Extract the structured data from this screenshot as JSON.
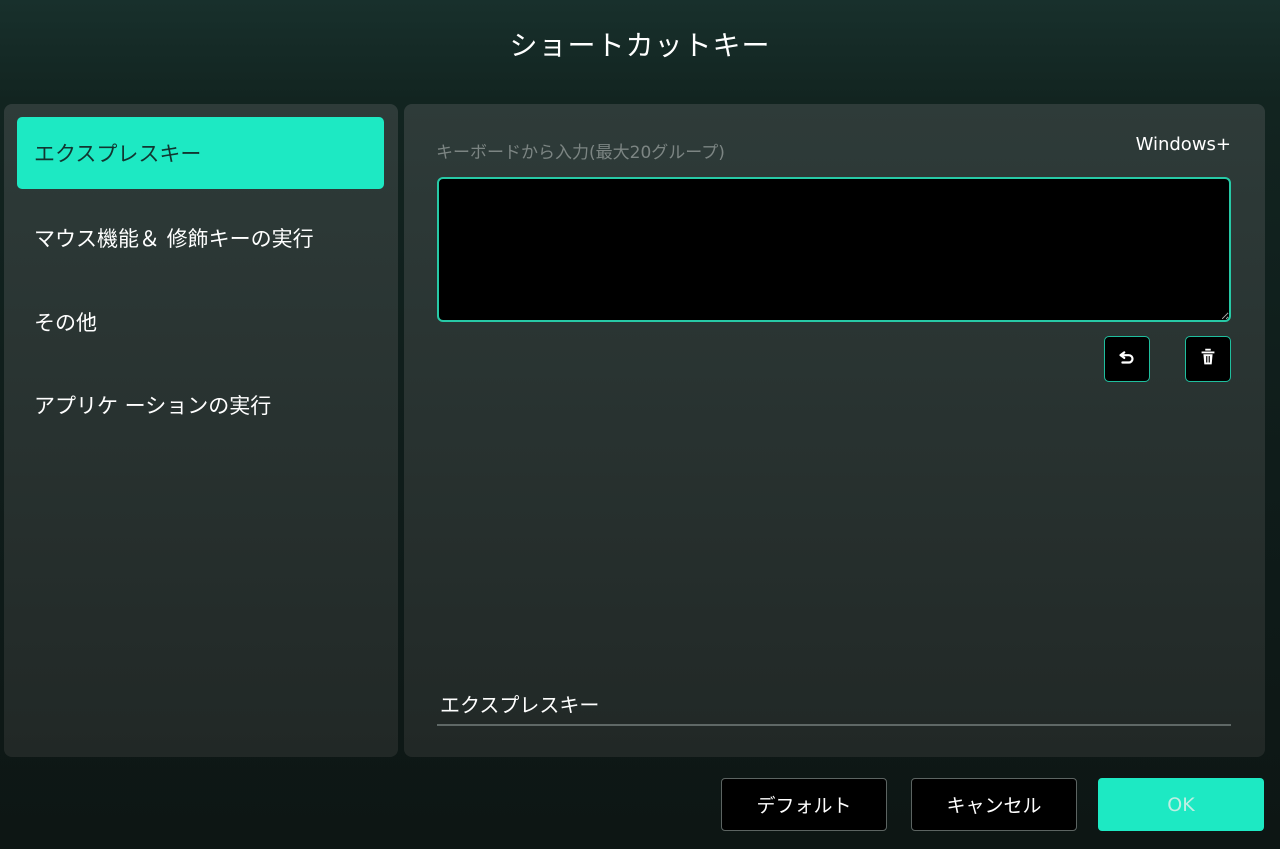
{
  "dialog": {
    "title": "ショートカットキー"
  },
  "sidebar": {
    "items": [
      {
        "label": "エクスプレスキー",
        "active": true
      },
      {
        "label": "マウス機能＆ 修飾キーの実行",
        "active": false
      },
      {
        "label": "その他",
        "active": false
      },
      {
        "label": "アプリケ ーションの実行",
        "active": false
      }
    ]
  },
  "main": {
    "input_label": "キーボードから入力(最大20グループ)",
    "modifier_label": "Windows+",
    "key_input_value": "",
    "undo_icon": "undo-icon",
    "delete_icon": "trash-icon",
    "name_value": "エクスプレスキー"
  },
  "footer": {
    "default_label": "デフォルト",
    "cancel_label": "キャンセル",
    "ok_label": "OK"
  },
  "colors": {
    "accent": "#1de9c3",
    "panel": "#283230",
    "background": "#0f1c1a"
  }
}
